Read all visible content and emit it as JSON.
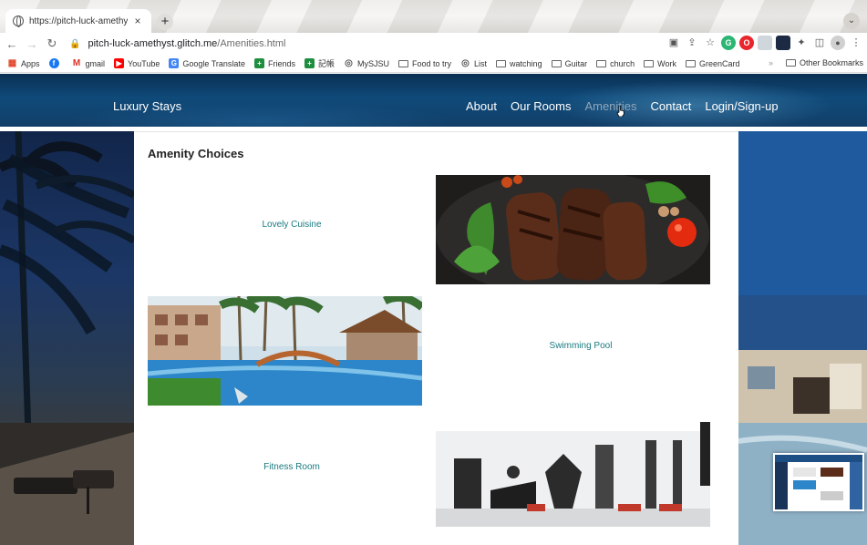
{
  "browser": {
    "tab_title": "https://pitch-luck-amethyst.gl",
    "tab_close": "×",
    "new_tab": "+",
    "url_host": "pitch-luck-amethyst.glitch.me",
    "url_path": "/Amenities.html",
    "bookmarks": [
      {
        "label": "Apps",
        "icon": "apps-grid-icon"
      },
      {
        "label": "",
        "icon": "facebook-icon"
      },
      {
        "label": "gmail",
        "icon": "gmail-icon"
      },
      {
        "label": "YouTube",
        "icon": "youtube-icon"
      },
      {
        "label": "Google Translate",
        "icon": "translate-icon"
      },
      {
        "label": "Friends",
        "icon": "green-plus-icon"
      },
      {
        "label": "記帳",
        "icon": "green-plus-icon"
      },
      {
        "label": "MySJSU",
        "icon": "globe-icon"
      },
      {
        "label": "Food to try",
        "icon": "folder-icon"
      },
      {
        "label": "List",
        "icon": "globe-icon"
      },
      {
        "label": "watching",
        "icon": "folder-icon"
      },
      {
        "label": "Guitar",
        "icon": "folder-icon"
      },
      {
        "label": "church",
        "icon": "folder-icon"
      },
      {
        "label": "Work",
        "icon": "folder-icon"
      },
      {
        "label": "GreenCard",
        "icon": "folder-icon"
      }
    ],
    "bookmarks_overflow": "»",
    "other_bookmarks": "Other Bookmarks"
  },
  "site": {
    "brand": "Luxury Stays",
    "nav": [
      "About",
      "Our Rooms",
      "Amenities",
      "Contact",
      "Login/Sign-up"
    ],
    "active_nav": "Amenities",
    "page_title": "Amenity Choices",
    "amenities": [
      {
        "label": "Lovely Cuisine",
        "photo": "grilled-meat-photo"
      },
      {
        "label": "Swimming Pool",
        "photo": "resort-pool-photo"
      },
      {
        "label": "Fitness Room",
        "photo": "gym-equipment-photo"
      }
    ]
  },
  "colors": {
    "header_blue": "#0f4a7a",
    "nav_active": "#8fa6b9",
    "amenity_link": "#1a7a80"
  }
}
